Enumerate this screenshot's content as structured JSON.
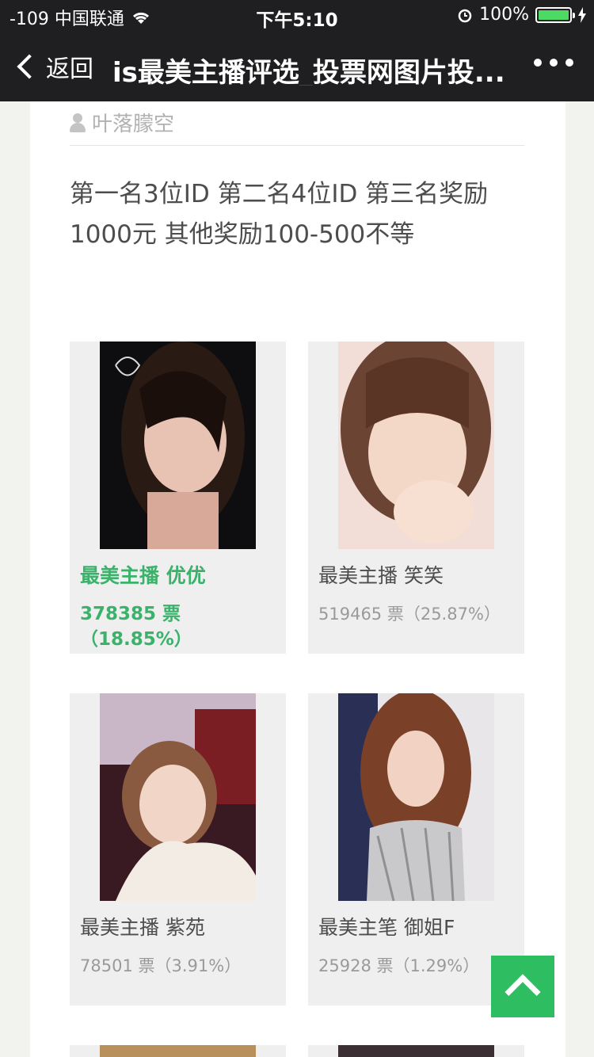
{
  "status": {
    "carrier": "-109 中国联通",
    "time": "下午5:10",
    "battery": "100%"
  },
  "nav": {
    "back_label": "返回",
    "title": "is最美主播评选_投票网图片投..."
  },
  "article": {
    "author": "叶落朦空",
    "description": "第一名3位ID  第二名4位ID 第三名奖励1000元 其他奖励100-500不等"
  },
  "candidates": [
    {
      "name": "最美主播 优优",
      "votes": "378385 票（18.85%）",
      "active": true
    },
    {
      "name": "最美主播 笑笑",
      "votes": "519465 票（25.87%）"
    },
    {
      "name": "最美主播 紫苑",
      "votes": "78501 票（3.91%）"
    },
    {
      "name": "最美主笔 御姐F",
      "votes": "25928 票（1.29%）"
    }
  ],
  "colors": {
    "accent_green": "#2ebd61",
    "active_text": "#3ab26a",
    "nav_bg": "#1f1f21"
  }
}
